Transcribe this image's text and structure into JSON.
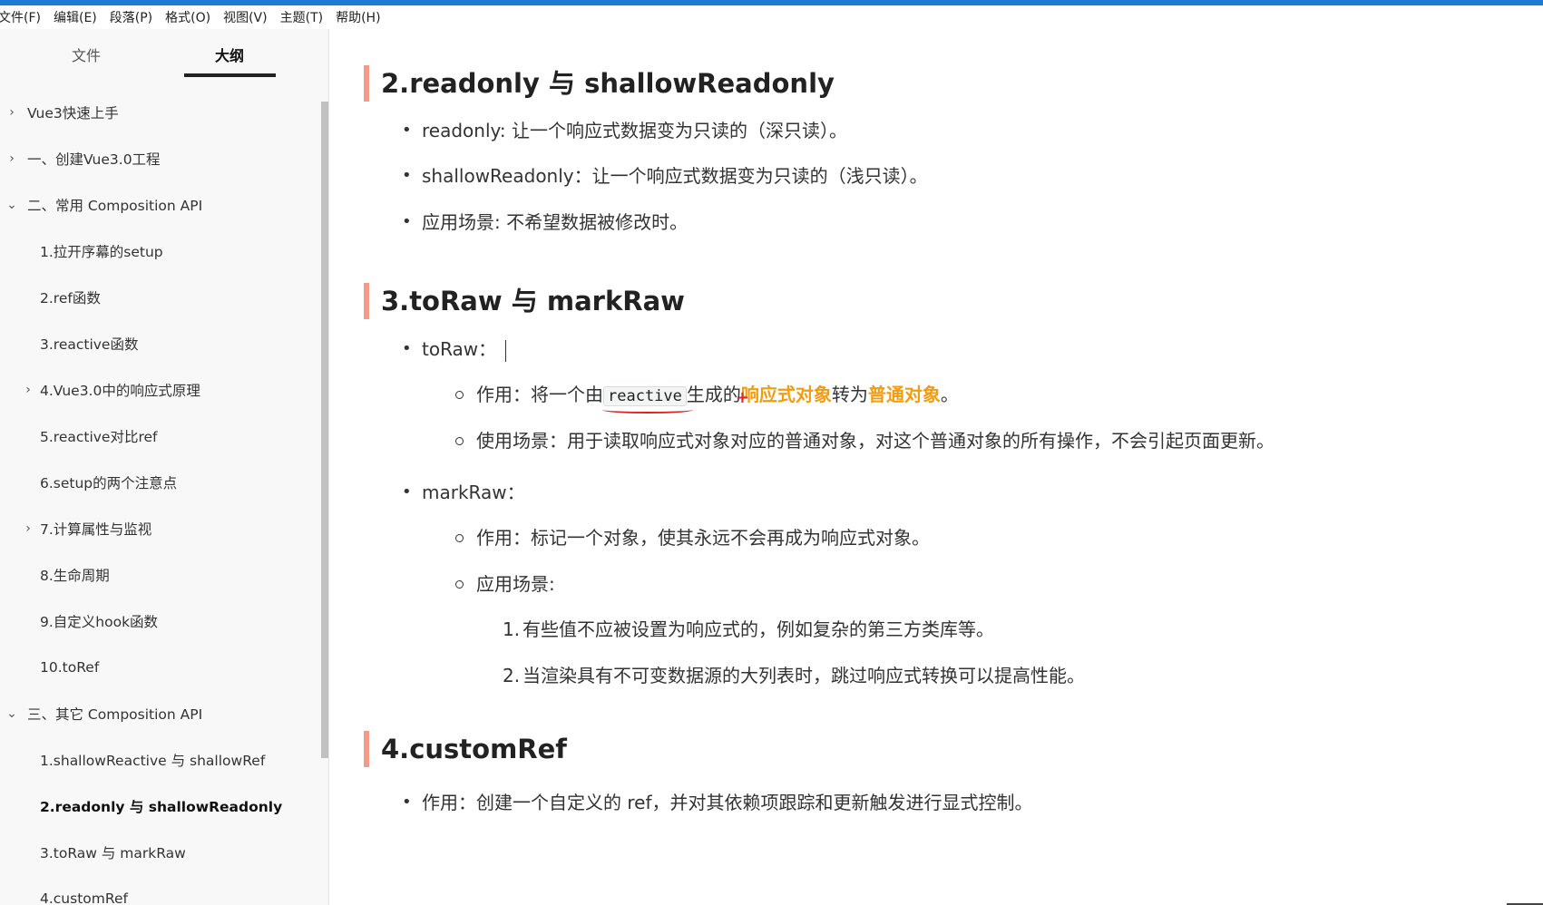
{
  "menu": [
    "文件(F)",
    "编辑(E)",
    "段落(P)",
    "格式(O)",
    "视图(V)",
    "主题(T)",
    "帮助(H)"
  ],
  "sidebar": {
    "tabs": {
      "file": "文件",
      "outline": "大纲"
    },
    "items": [
      {
        "label": "Vue3快速上手"
      },
      {
        "label": "一、创建Vue3.0工程"
      },
      {
        "label": "二、常用 Composition API"
      },
      {
        "label": "1.拉开序幕的setup"
      },
      {
        "label": "2.ref函数"
      },
      {
        "label": "3.reactive函数"
      },
      {
        "label": "4.Vue3.0中的响应式原理"
      },
      {
        "label": "5.reactive对比ref"
      },
      {
        "label": "6.setup的两个注意点"
      },
      {
        "label": "7.计算属性与监视"
      },
      {
        "label": "8.生命周期"
      },
      {
        "label": "9.自定义hook函数"
      },
      {
        "label": "10.toRef"
      },
      {
        "label": "三、其它 Composition API"
      },
      {
        "label": "1.shallowReactive 与 shallowRef"
      },
      {
        "label": "2.readonly 与 shallowReadonly"
      },
      {
        "label": "3.toRaw 与 markRaw"
      },
      {
        "label": "4.customRef"
      }
    ]
  },
  "doc": {
    "h_readonly": "2.readonly 与 shallowReadonly",
    "readonly_1": "readonly: 让一个响应式数据变为只读的（深只读）。",
    "readonly_2": "shallowReadonly：让一个响应式数据变为只读的（浅只读）。",
    "readonly_3": "应用场景: 不希望数据被修改时。",
    "h_toraw": "3.toRaw 与 markRaw",
    "toraw_label": "toRaw：",
    "toraw_use_prefix": "作用：将一个由",
    "toraw_use_code": "reactive",
    "toraw_use_mid": "生成的",
    "toraw_use_hl1": "响应式对象",
    "toraw_use_mid2": "转为",
    "toraw_use_hl2": "普通对象",
    "toraw_use_end": "。",
    "toraw_scene": "使用场景：用于读取响应式对象对应的普通对象，对这个普通对象的所有操作，不会引起页面更新。",
    "markraw_label": "markRaw：",
    "markraw_use": "作用：标记一个对象，使其永远不会再成为响应式对象。",
    "markraw_scene": "应用场景:",
    "markraw_n1": "有些值不应被设置为响应式的，例如复杂的第三方类库等。",
    "markraw_n2": "当渲染具有不可变数据源的大列表时，跳过响应式转换可以提高性能。",
    "h_customref": "4.customRef",
    "customref_use": "作用：创建一个自定义的 ref，并对其依赖项跟踪和更新触发进行显式控制。"
  }
}
